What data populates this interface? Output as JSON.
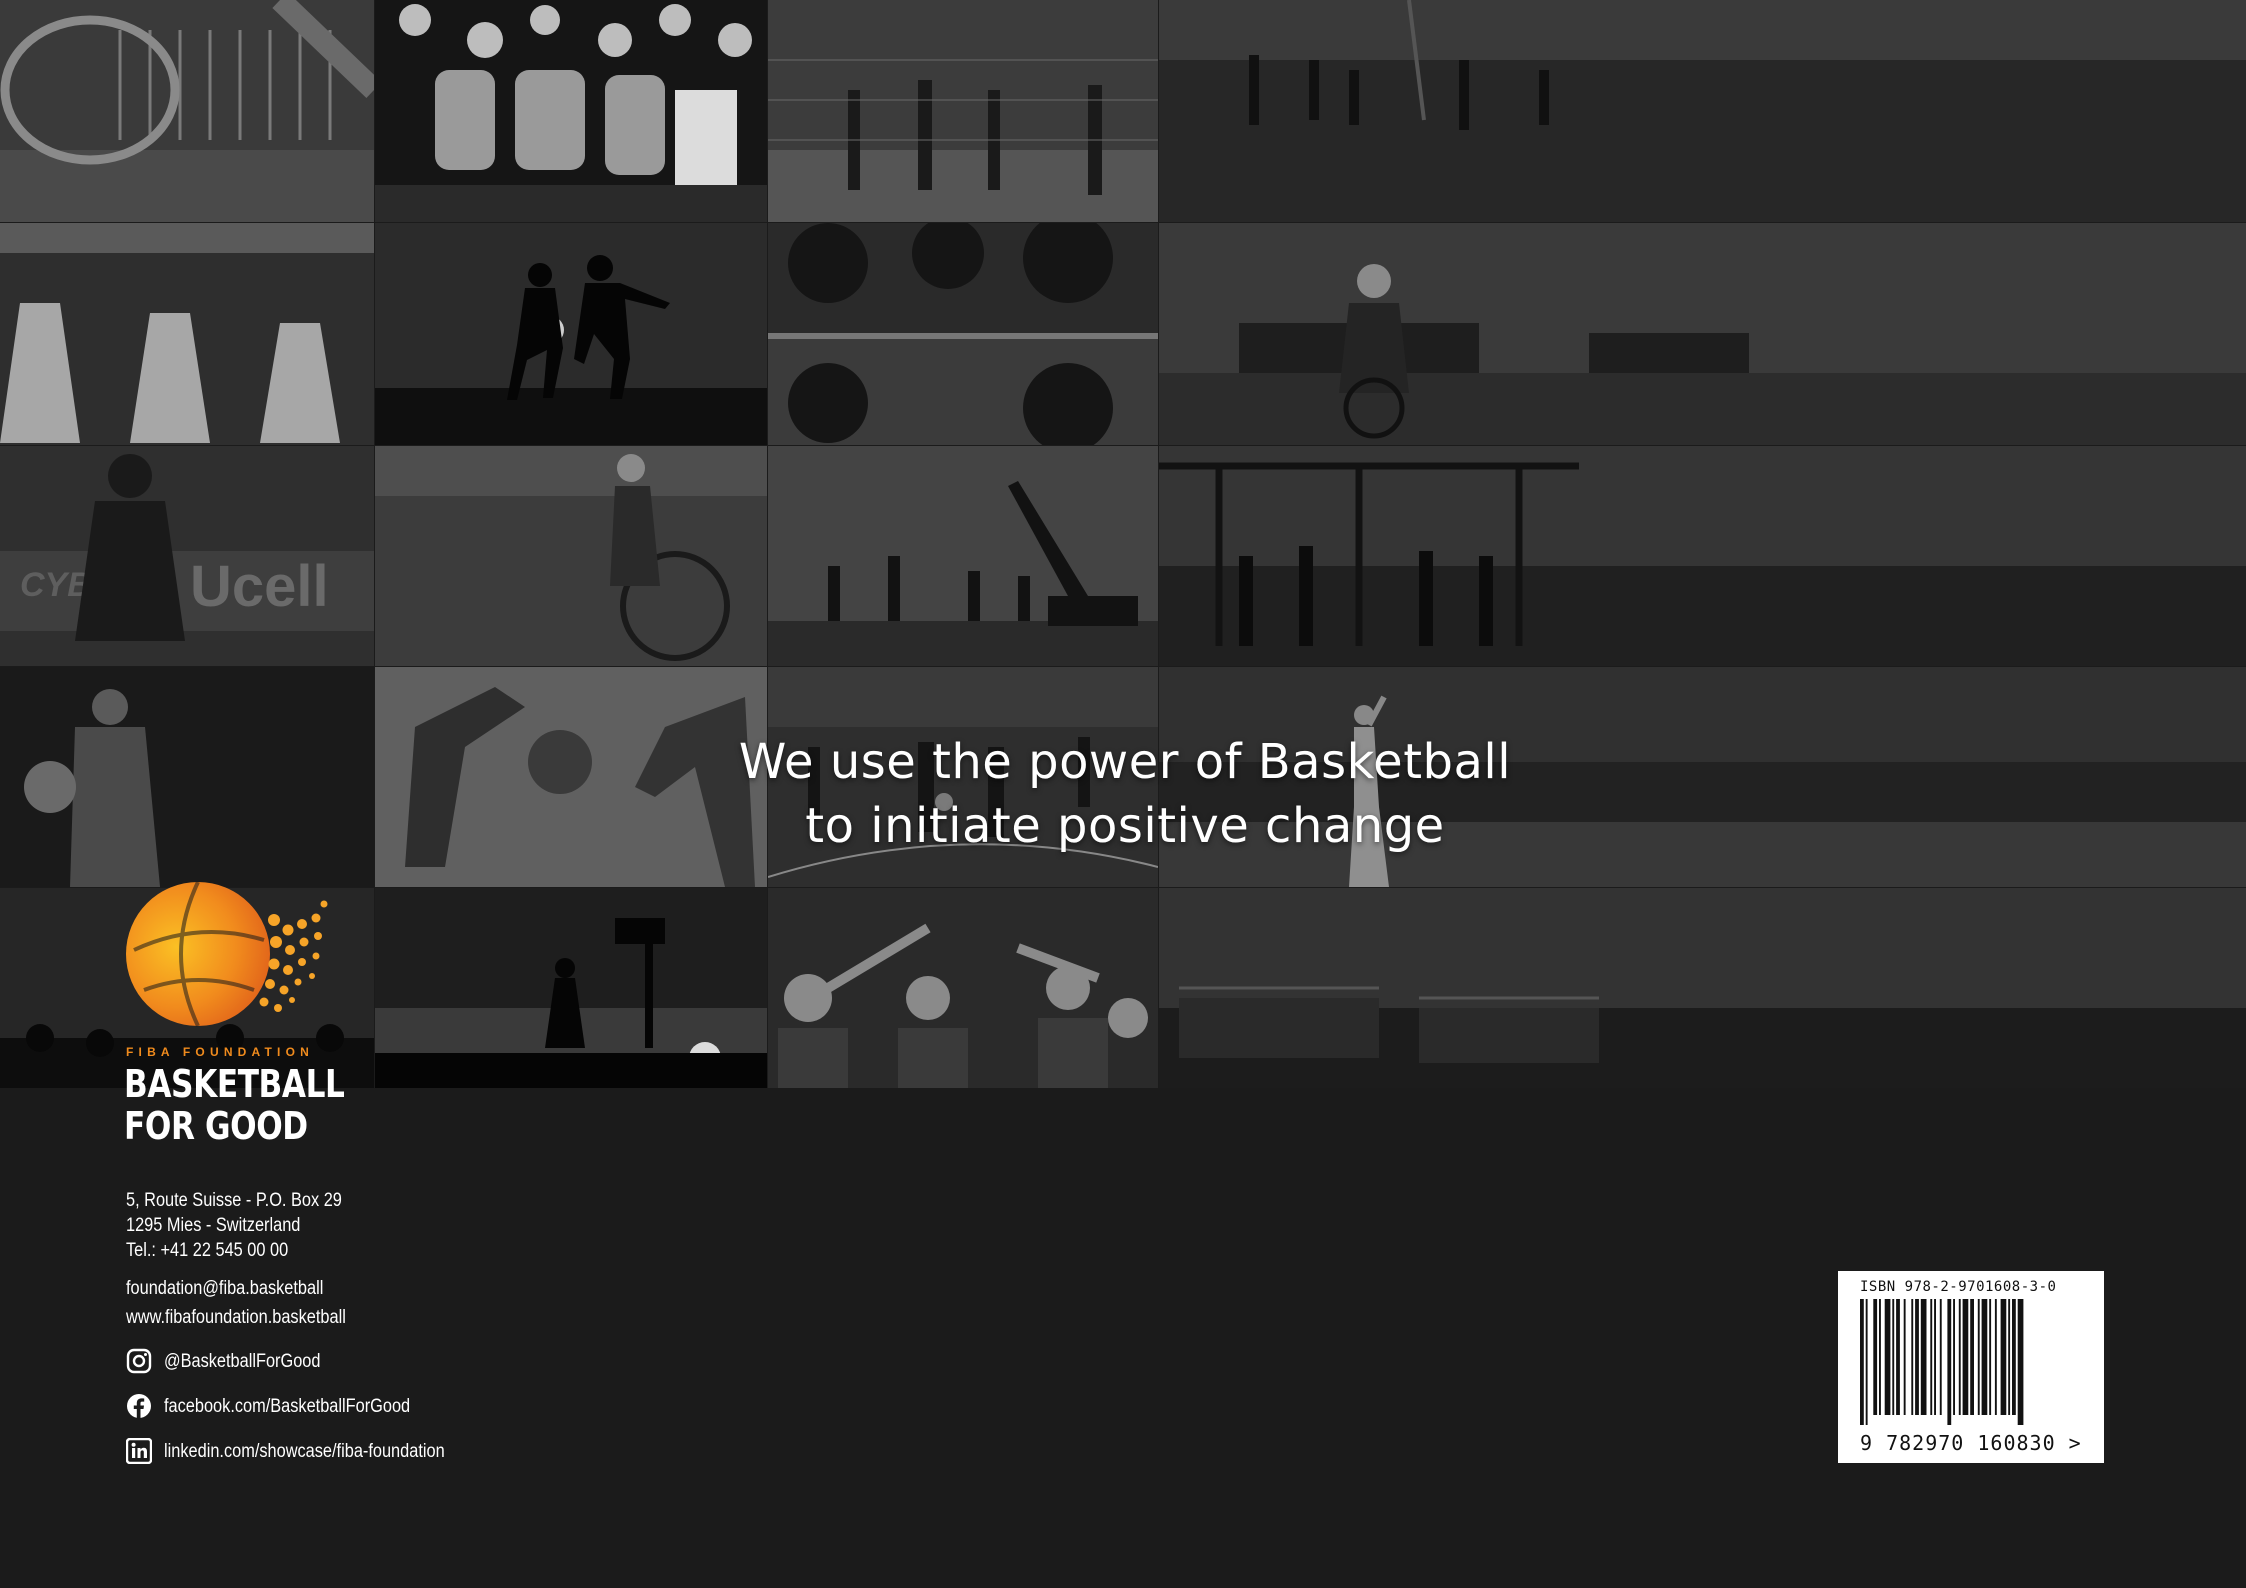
{
  "headline": {
    "line1": "We use the power of Basketball",
    "line2": "to initiate positive change"
  },
  "brand": {
    "org_small": "FIBA FOUNDATION",
    "name_line1": "BASKETBALL",
    "name_line2": "FOR GOOD",
    "accent_color": "#f08b1d"
  },
  "contact": {
    "address_line1": "5, Route Suisse - P.O. Box 29",
    "address_line2": "1295 Mies - Switzerland",
    "phone": "Tel.: +41 22 545 00 00",
    "email": "foundation@fiba.basketball",
    "website": "www.fibafoundation.basketball"
  },
  "social": [
    {
      "icon": "instagram-icon",
      "label": "@BasketballForGood"
    },
    {
      "icon": "facebook-icon",
      "label": "facebook.com/BasketballForGood"
    },
    {
      "icon": "linkedin-icon",
      "label": "linkedin.com/showcase/fiba-foundation"
    }
  ],
  "isbn": {
    "top_text": "ISBN 978-2-9701608-3-0",
    "bottom_text": "9 782970 160830 >"
  },
  "photo_tiles": [
    "basketball-hoop-rim-photo",
    "cheering-crowd-photo",
    "street-court-fence-photo",
    "flooded-beach-game-photo",
    "nuns-playing-photo",
    "silhouette-players-sunset-photo",
    "flooded-park-court-photo",
    "wheelchair-player-ball-photo",
    "coach-child-court-photo",
    "wheelchair-athlete-photo",
    "excavator-court-game-photo",
    "players-under-structure-photo",
    "night-street-player-photo",
    "two-players-reaching-photo",
    "village-court-game-photo",
    "boy-shooting-sea-photo",
    "street-crowd-night-photo",
    "silhouette-dunk-sunset-photo",
    "wheelchair-group-cheer-photo",
    "stilt-houses-village-photo"
  ]
}
